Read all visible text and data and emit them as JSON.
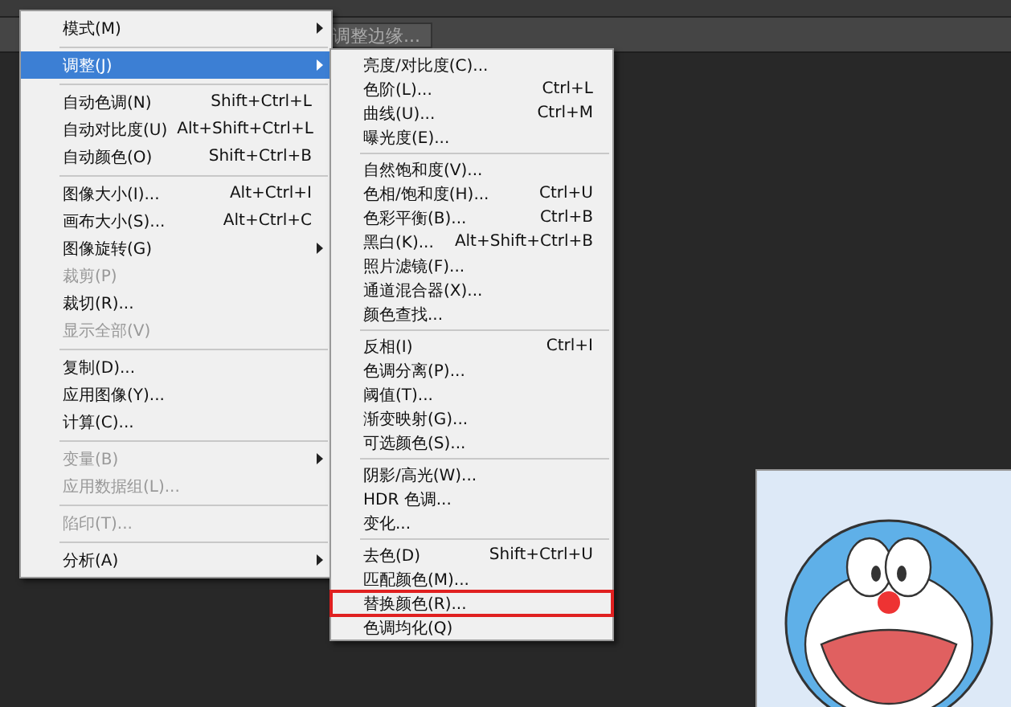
{
  "options_bar": {
    "button": "调整边缘..."
  },
  "image_menu": {
    "items": [
      {
        "kind": "item",
        "label": "模式(M)",
        "submenu": true,
        "selected": false,
        "disabled": false
      },
      {
        "kind": "separator"
      },
      {
        "kind": "item",
        "label": "调整(J)",
        "submenu": true,
        "selected": true,
        "disabled": false
      },
      {
        "kind": "separator"
      },
      {
        "kind": "item",
        "label": "自动色调(N)",
        "shortcut": "Shift+Ctrl+L",
        "submenu": false,
        "selected": false,
        "disabled": false
      },
      {
        "kind": "item",
        "label": "自动对比度(U)",
        "shortcut": "Alt+Shift+Ctrl+L",
        "submenu": false,
        "selected": false,
        "disabled": false
      },
      {
        "kind": "item",
        "label": "自动颜色(O)",
        "shortcut": "Shift+Ctrl+B",
        "submenu": false,
        "selected": false,
        "disabled": false
      },
      {
        "kind": "separator"
      },
      {
        "kind": "item",
        "label": "图像大小(I)...",
        "shortcut": "Alt+Ctrl+I",
        "submenu": false,
        "selected": false,
        "disabled": false
      },
      {
        "kind": "item",
        "label": "画布大小(S)...",
        "shortcut": "Alt+Ctrl+C",
        "submenu": false,
        "selected": false,
        "disabled": false
      },
      {
        "kind": "item",
        "label": "图像旋转(G)",
        "submenu": true,
        "selected": false,
        "disabled": false
      },
      {
        "kind": "item",
        "label": "裁剪(P)",
        "submenu": false,
        "selected": false,
        "disabled": true
      },
      {
        "kind": "item",
        "label": "裁切(R)...",
        "submenu": false,
        "selected": false,
        "disabled": false
      },
      {
        "kind": "item",
        "label": "显示全部(V)",
        "submenu": false,
        "selected": false,
        "disabled": true
      },
      {
        "kind": "separator"
      },
      {
        "kind": "item",
        "label": "复制(D)...",
        "submenu": false,
        "selected": false,
        "disabled": false
      },
      {
        "kind": "item",
        "label": "应用图像(Y)...",
        "submenu": false,
        "selected": false,
        "disabled": false
      },
      {
        "kind": "item",
        "label": "计算(C)...",
        "submenu": false,
        "selected": false,
        "disabled": false
      },
      {
        "kind": "separator"
      },
      {
        "kind": "item",
        "label": "变量(B)",
        "submenu": true,
        "selected": false,
        "disabled": true
      },
      {
        "kind": "item",
        "label": "应用数据组(L)...",
        "submenu": false,
        "selected": false,
        "disabled": true
      },
      {
        "kind": "separator"
      },
      {
        "kind": "item",
        "label": "陷印(T)...",
        "submenu": false,
        "selected": false,
        "disabled": true
      },
      {
        "kind": "separator"
      },
      {
        "kind": "item",
        "label": "分析(A)",
        "submenu": true,
        "selected": false,
        "disabled": false
      }
    ]
  },
  "adjust_submenu": {
    "items": [
      {
        "kind": "item",
        "label": "亮度/对比度(C)...",
        "highlighted": false
      },
      {
        "kind": "item",
        "label": "色阶(L)...",
        "shortcut": "Ctrl+L",
        "highlighted": false
      },
      {
        "kind": "item",
        "label": "曲线(U)...",
        "shortcut": "Ctrl+M",
        "highlighted": false
      },
      {
        "kind": "item",
        "label": "曝光度(E)...",
        "highlighted": false
      },
      {
        "kind": "separator"
      },
      {
        "kind": "item",
        "label": "自然饱和度(V)...",
        "highlighted": false
      },
      {
        "kind": "item",
        "label": "色相/饱和度(H)...",
        "shortcut": "Ctrl+U",
        "highlighted": false
      },
      {
        "kind": "item",
        "label": "色彩平衡(B)...",
        "shortcut": "Ctrl+B",
        "highlighted": false
      },
      {
        "kind": "item",
        "label": "黑白(K)...",
        "shortcut": "Alt+Shift+Ctrl+B",
        "highlighted": false
      },
      {
        "kind": "item",
        "label": "照片滤镜(F)...",
        "highlighted": false
      },
      {
        "kind": "item",
        "label": "通道混合器(X)...",
        "highlighted": false
      },
      {
        "kind": "item",
        "label": "颜色查找...",
        "highlighted": false
      },
      {
        "kind": "separator"
      },
      {
        "kind": "item",
        "label": "反相(I)",
        "shortcut": "Ctrl+I",
        "highlighted": false
      },
      {
        "kind": "item",
        "label": "色调分离(P)...",
        "highlighted": false
      },
      {
        "kind": "item",
        "label": "阈值(T)...",
        "highlighted": false
      },
      {
        "kind": "item",
        "label": "渐变映射(G)...",
        "highlighted": false
      },
      {
        "kind": "item",
        "label": "可选颜色(S)...",
        "highlighted": false
      },
      {
        "kind": "separator"
      },
      {
        "kind": "item",
        "label": "阴影/高光(W)...",
        "highlighted": false
      },
      {
        "kind": "item",
        "label": "HDR 色调...",
        "highlighted": false
      },
      {
        "kind": "item",
        "label": "变化...",
        "highlighted": false
      },
      {
        "kind": "separator"
      },
      {
        "kind": "item",
        "label": "去色(D)",
        "shortcut": "Shift+Ctrl+U",
        "highlighted": false
      },
      {
        "kind": "item",
        "label": "匹配颜色(M)...",
        "highlighted": false
      },
      {
        "kind": "item",
        "label": "替换颜色(R)...",
        "highlighted": true
      },
      {
        "kind": "item",
        "label": "色调均化(Q)",
        "highlighted": false
      }
    ]
  }
}
